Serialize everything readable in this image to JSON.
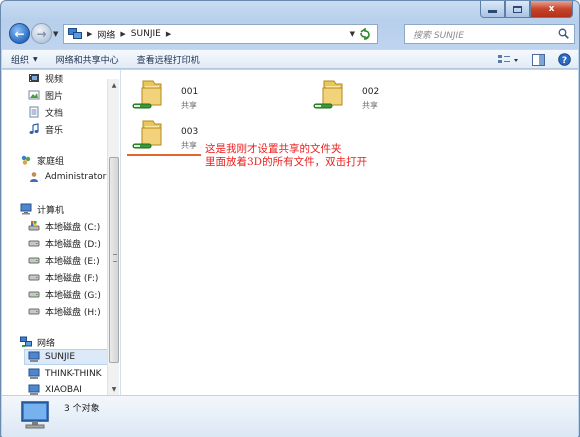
{
  "window": {
    "caption_buttons": {
      "close_glyph": "x"
    }
  },
  "navigation": {
    "breadcrumbs": [
      "网络",
      "SUNJIE"
    ],
    "search_placeholder": "搜索 SUNJIE"
  },
  "toolbar": {
    "items": [
      {
        "label": "组织",
        "has_dropdown": true
      },
      {
        "label": "网络和共享中心",
        "has_dropdown": false
      },
      {
        "label": "查看远程打印机",
        "has_dropdown": false
      }
    ],
    "right_icons": [
      "view-options-icon",
      "preview-pane-icon",
      "help-icon"
    ]
  },
  "sidebar": {
    "libraries": [
      {
        "label": "视频",
        "icon": "video-library-icon"
      },
      {
        "label": "图片",
        "icon": "pictures-library-icon"
      },
      {
        "label": "文档",
        "icon": "documents-library-icon"
      },
      {
        "label": "音乐",
        "icon": "music-library-icon"
      }
    ],
    "homegroup": {
      "label": "家庭组",
      "icon": "homegroup-icon"
    },
    "homegroup_user": {
      "label": "Administrator (",
      "icon": "user-icon"
    },
    "computer": {
      "label": "计算机",
      "icon": "computer-icon"
    },
    "drives": [
      {
        "label": "本地磁盘 (C:)"
      },
      {
        "label": "本地磁盘 (D:)"
      },
      {
        "label": "本地磁盘 (E:)"
      },
      {
        "label": "本地磁盘 (F:)"
      },
      {
        "label": "本地磁盘 (G:)"
      },
      {
        "label": "本地磁盘 (H:)"
      }
    ],
    "network": {
      "label": "网络",
      "icon": "network-icon"
    },
    "network_items": [
      {
        "label": "SUNJIE",
        "selected": true
      },
      {
        "label": "THINK-THINK",
        "selected": false
      },
      {
        "label": "XIAOBAI",
        "selected": false
      }
    ]
  },
  "content": {
    "folders": [
      {
        "name": "001",
        "sub": "共享"
      },
      {
        "name": "002",
        "sub": "共享"
      },
      {
        "name": "003",
        "sub": "共享"
      }
    ],
    "annotation": {
      "line1": "这是我刚才设置共享的文件夹",
      "line2": "里面放着3D的所有文件，双击打开",
      "color": "#ee1d1d"
    }
  },
  "status": {
    "count_text": "3 个对象"
  }
}
